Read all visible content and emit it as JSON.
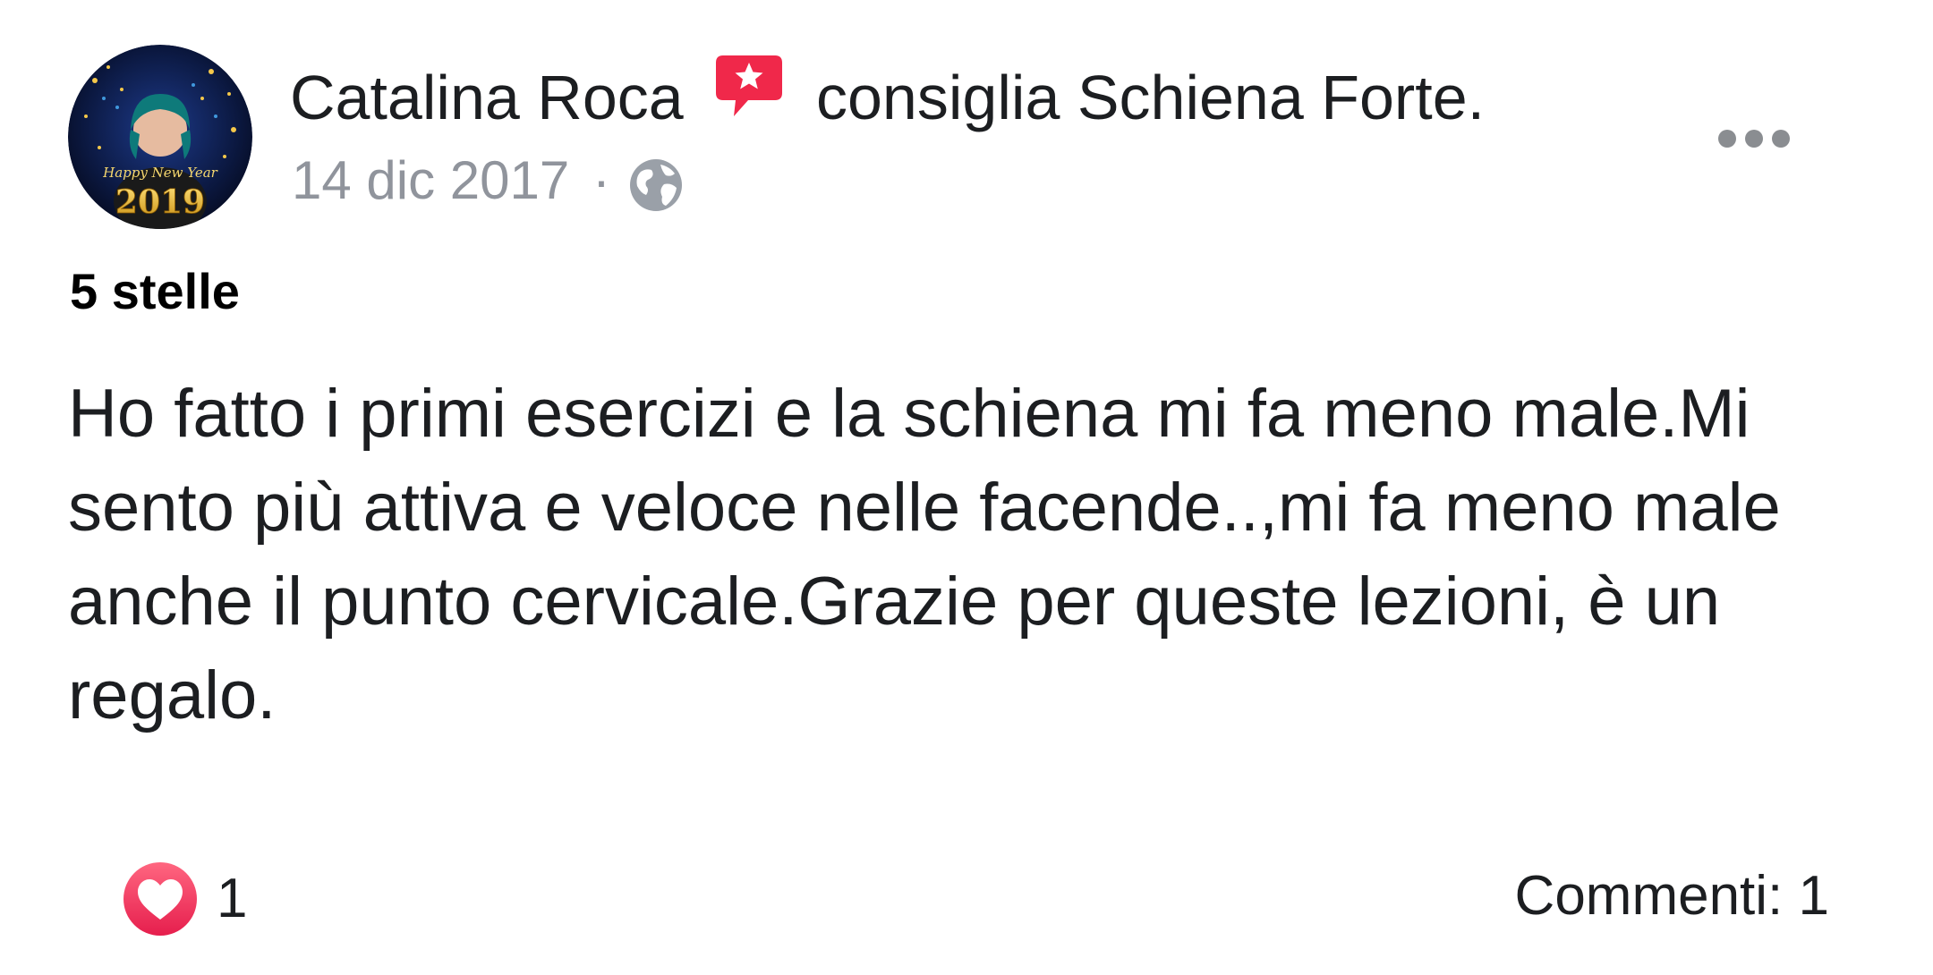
{
  "post": {
    "author_name": "Catalina Roca",
    "recommend_prefix": "consiglia ",
    "page_name": "Schiena Forte",
    "recommend_suffix": ".",
    "timestamp": "14 dic 2017",
    "separator": "·",
    "privacy_icon": "globe-icon",
    "recommend_icon": "recommend-star-icon",
    "more_icon": "more-options-icon",
    "rating": "5 stelle",
    "body": "Ho fatto i primi esercizi e la schiena mi fa meno male.Mi sento più attiva e veloce nelle facende..,mi fa meno male anche il punto cervicale.Grazie per queste lezioni, è un regalo.",
    "avatar_caption": "2019",
    "avatar_script": "Happy New Year"
  },
  "footer": {
    "reaction_icon": "love-reaction-icon",
    "reaction_count": "1",
    "comments_label": "Commenti: 1"
  },
  "colors": {
    "text_primary": "#1c1e21",
    "text_secondary": "#90949c",
    "recommend_red": "#f0284a",
    "love_red": "#f33e58"
  }
}
